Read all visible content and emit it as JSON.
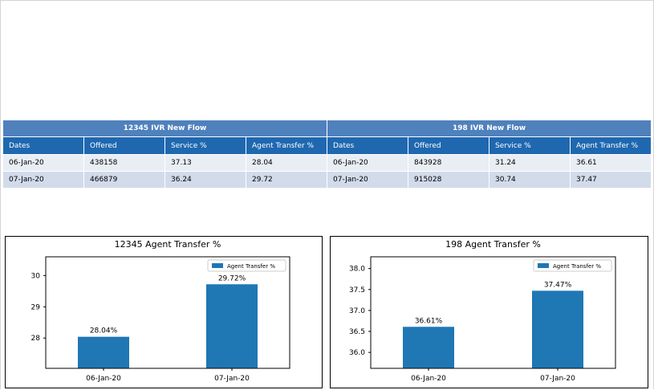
{
  "tables": [
    {
      "title": "12345 IVR New Flow",
      "headers": [
        "Dates",
        "Offered",
        "Service %",
        "Agent Transfer %"
      ],
      "rows": [
        [
          "06-Jan-20",
          "438158",
          "37.13",
          "28.04"
        ],
        [
          "07-Jan-20",
          "466879",
          "36.24",
          "29.72"
        ]
      ]
    },
    {
      "title": "198 IVR New Flow",
      "headers": [
        "Dates",
        "Offered",
        "Service %",
        "Agent Transfer %"
      ],
      "rows": [
        [
          "06-Jan-20",
          "843928",
          "31.24",
          "36.61"
        ],
        [
          "07-Jan-20",
          "915028",
          "30.74",
          "37.47"
        ]
      ]
    }
  ],
  "colors": {
    "header_title": "#4f81bd",
    "header_cols": "#1f68b0",
    "bar": "#1f77b4"
  },
  "chart_data": [
    {
      "type": "bar",
      "title": "12345 Agent Transfer %",
      "categories": [
        "06-Jan-20",
        "07-Jan-20"
      ],
      "series": [
        {
          "name": "Agent Transfer %",
          "values": [
            28.04,
            29.72
          ]
        }
      ],
      "data_labels": [
        "28.04%",
        "29.72%"
      ],
      "yticks": [
        28,
        29,
        30
      ],
      "ylim": [
        27.03,
        30.6
      ],
      "legend": "top-right",
      "grid": false
    },
    {
      "type": "bar",
      "title": "198 Agent Transfer %",
      "categories": [
        "06-Jan-20",
        "07-Jan-20"
      ],
      "series": [
        {
          "name": "Agent Transfer %",
          "values": [
            36.61,
            37.47
          ]
        }
      ],
      "data_labels": [
        "36.61%",
        "37.47%"
      ],
      "yticks": [
        36.0,
        36.5,
        37.0,
        37.5,
        38.0
      ],
      "ylag": null,
      "ylim": [
        35.62,
        38.28
      ],
      "legend": "top-right",
      "grid": false
    }
  ]
}
